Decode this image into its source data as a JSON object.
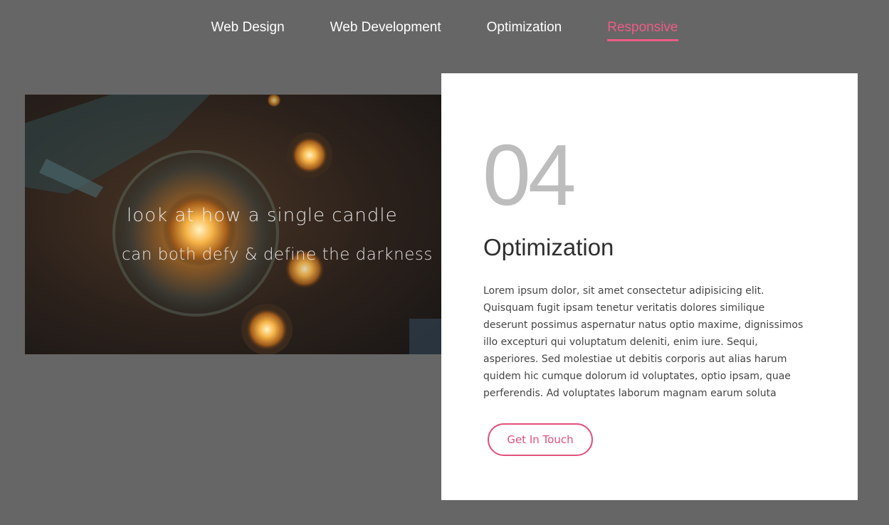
{
  "tabs": [
    {
      "label": "Web Design"
    },
    {
      "label": "Web Development"
    },
    {
      "label": "Optimization"
    },
    {
      "label": "Responsive",
      "active": true
    }
  ],
  "photo": {
    "caption_line1": "look at how a single candle",
    "caption_line2": "can both defy & define the darkness"
  },
  "card": {
    "number": "04",
    "title": "Optimization",
    "body": "Lorem ipsum dolor, sit amet consectetur adipisicing elit. Quisquam fugit ipsam tenetur veritatis dolores similique deserunt possimus aspernatur natus optio maxime, dignissimos illo excepturi qui voluptatum deleniti, enim iure. Sequi, asperiores. Sed molestiae ut debitis corporis aut alias harum quidem hic cumque dolorum id voluptates, optio ipsam, quae perferendis. Ad voluptates laborum magnam earum soluta",
    "button_label": "Get In Touch"
  },
  "colors": {
    "accent": "#ec5d85",
    "background": "#666666",
    "card": "#ffffff",
    "number": "#bdbdbd"
  }
}
